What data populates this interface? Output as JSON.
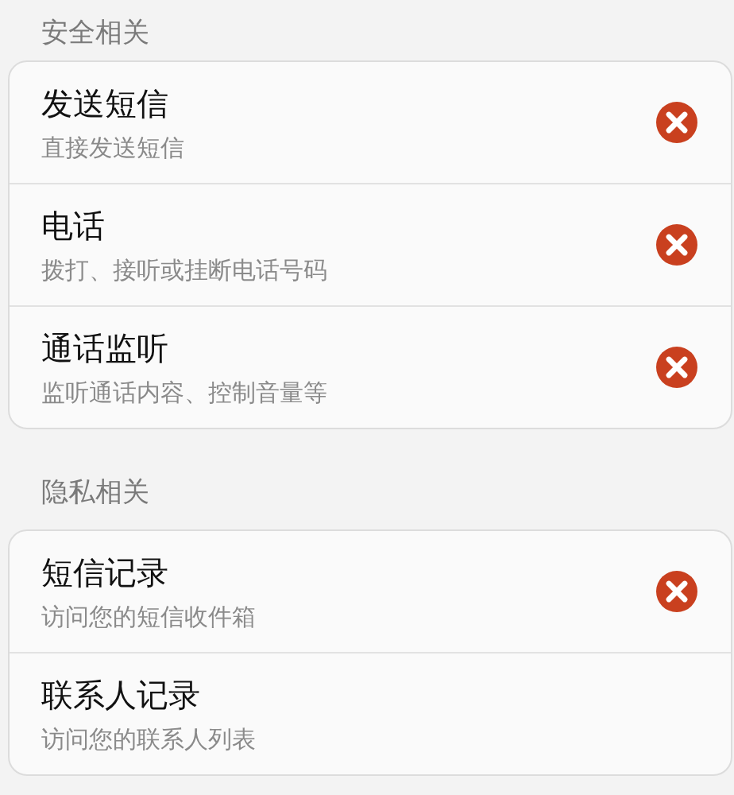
{
  "sections": [
    {
      "title": "安全相关",
      "items": [
        {
          "title": "发送短信",
          "subtitle": "直接发送短信",
          "removable": true
        },
        {
          "title": "电话",
          "subtitle": "拨打、接听或挂断电话号码",
          "removable": true
        },
        {
          "title": "通话监听",
          "subtitle": "监听通话内容、控制音量等",
          "removable": true
        }
      ]
    },
    {
      "title": "隐私相关",
      "items": [
        {
          "title": "短信记录",
          "subtitle": "访问您的短信收件箱",
          "removable": true
        },
        {
          "title": "联系人记录",
          "subtitle": "访问您的联系人列表"
        }
      ]
    }
  ]
}
